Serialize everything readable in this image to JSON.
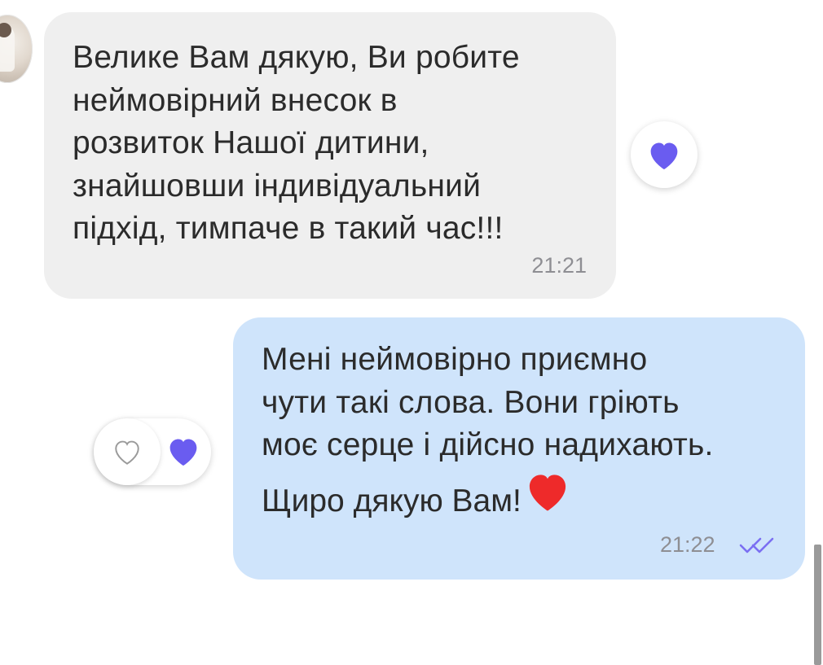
{
  "incoming": {
    "text": "Велике Вам дякую, Ви робите\nнеймовірний внесок в\nрозвиток Нашої дитини,\nзнайшовши індивідуальний\nпідхід, тимпаче в такий час!!!",
    "time": "21:21",
    "reaction_icon": "heart-purple"
  },
  "outgoing": {
    "text": "Мені неймовірно приємно\nчути такі слова. Вони гріють\nмоє серце і дійсно надихають.",
    "text2": "Щиро дякую Вам!",
    "emoji": "❤",
    "time": "21:22",
    "status_icon": "double-check",
    "reaction_add_icon": "heart-outline",
    "reaction_icon": "heart-purple"
  },
  "colors": {
    "incoming_bubble": "#efefef",
    "outgoing_bubble": "#cfe4fb",
    "reaction_heart": "#6a5cf0",
    "emoji_heart": "#ee2a2a",
    "read_ticks": "#7b6ff2"
  }
}
